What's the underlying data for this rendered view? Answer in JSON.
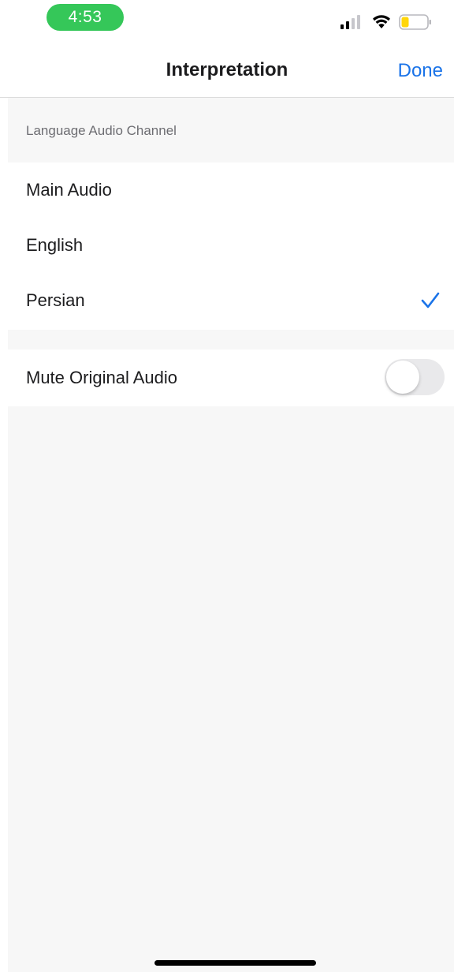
{
  "status_bar": {
    "time": "4:53",
    "time_pill_color": "#35c759",
    "icons": [
      "signal-icon",
      "wifi-icon",
      "battery-icon"
    ],
    "battery_level_color": "#ffd60a"
  },
  "nav": {
    "title": "Interpretation",
    "done_label": "Done",
    "accent_color": "#1a73e8"
  },
  "section": {
    "header": "Language Audio Channel"
  },
  "channels": [
    {
      "label": "Main Audio",
      "selected": false
    },
    {
      "label": "English",
      "selected": false
    },
    {
      "label": "Persian",
      "selected": true
    }
  ],
  "mute_original": {
    "label": "Mute Original Audio",
    "enabled": false
  }
}
